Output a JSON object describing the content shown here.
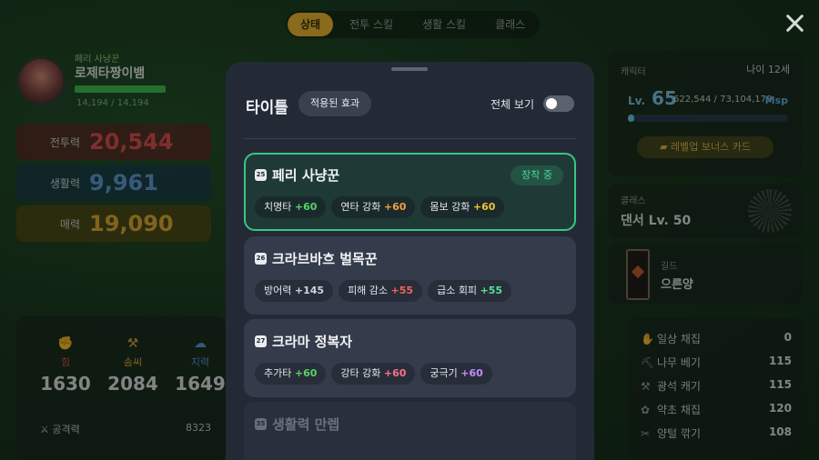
{
  "top_tabs": [
    {
      "label": "상태",
      "active": true
    },
    {
      "label": "전투 스킬",
      "active": false
    },
    {
      "label": "생활 스킬",
      "active": false
    },
    {
      "label": "클래스",
      "active": false
    }
  ],
  "profile": {
    "title": "페리 사냥꾼",
    "name": "로제타짱이뱀",
    "hp_text": "14,194 / 14,194",
    "hp_ratio": 1.0
  },
  "stats": [
    {
      "label": "전투력",
      "value": "20,544"
    },
    {
      "label": "생활력",
      "value": "9,961"
    },
    {
      "label": "매력",
      "value": "19,090"
    }
  ],
  "attributes": [
    {
      "name": "힘",
      "value": "1630",
      "color": "#e04a4a"
    },
    {
      "name": "솜씨",
      "value": "2084",
      "color": "#e3a92c"
    },
    {
      "name": "지력",
      "value": "1649",
      "color": "#5a9ad8"
    }
  ],
  "attack": {
    "label": "공격력",
    "value": "8323"
  },
  "character": {
    "label": "캐릭터",
    "age": "나이 12세",
    "level_prefix": "Lv.",
    "level": "65",
    "exp": "622,544 / 73,104,179",
    "unit": "Msp",
    "exp_ratio": 0.0085,
    "bonus_button": "레벨업 보너스 카드"
  },
  "class_info": {
    "label": "클래스",
    "value": "댄서 Lv. 50"
  },
  "guild": {
    "label": "길드",
    "value": "으른양"
  },
  "life_skills": [
    {
      "name": "일상 채집",
      "value": "0"
    },
    {
      "name": "나무 베기",
      "value": "115"
    },
    {
      "name": "광석 캐기",
      "value": "115"
    },
    {
      "name": "약초 채집",
      "value": "120"
    },
    {
      "name": "양털 깎기",
      "value": "108"
    }
  ],
  "modal": {
    "title": "타이틀",
    "applied_button": "적용된 효과",
    "show_all_label": "전체 보기",
    "show_all_on": false,
    "equipped_label": "장착 중",
    "titles": [
      {
        "num": "25",
        "name": "페리 사냥꾼",
        "equipped": true,
        "effects": [
          {
            "name": "치명타",
            "amount": "+60"
          },
          {
            "name": "연타 강화",
            "amount": "+60"
          },
          {
            "name": "몸보 강화",
            "amount": "+60"
          }
        ]
      },
      {
        "num": "26",
        "name": "크라브바흐 벌목꾼",
        "equipped": false,
        "effects": [
          {
            "name": "방어력",
            "amount": "+145"
          },
          {
            "name": "피해 감소",
            "amount": "+55"
          },
          {
            "name": "급소 회피",
            "amount": "+55"
          }
        ]
      },
      {
        "num": "27",
        "name": "크라마 정복자",
        "equipped": false,
        "effects": [
          {
            "name": "추가타",
            "amount": "+60"
          },
          {
            "name": "강타 강화",
            "amount": "+60"
          },
          {
            "name": "궁극기",
            "amount": "+60"
          }
        ]
      },
      {
        "num": "35",
        "name": "생활력 만렙",
        "equipped": false,
        "effects": []
      }
    ]
  }
}
